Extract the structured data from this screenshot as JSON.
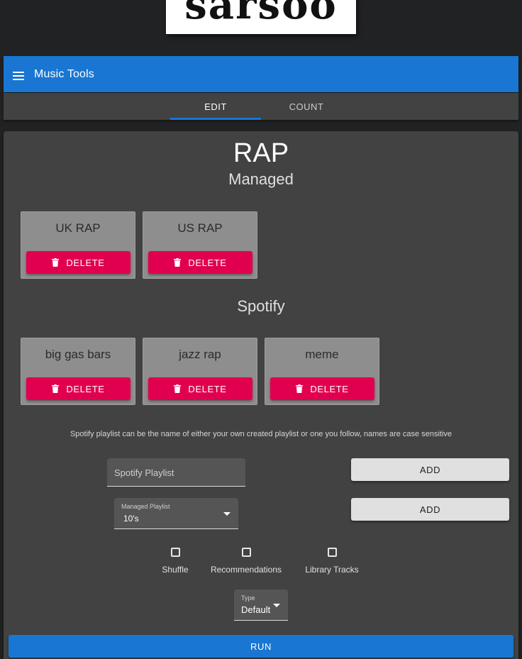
{
  "logo": {
    "text": "sarsoo"
  },
  "appbar": {
    "title": "Music Tools",
    "menu_icon": "menu-icon"
  },
  "tabs": [
    {
      "label": "EDIT",
      "active": true
    },
    {
      "label": "COUNT",
      "active": false
    }
  ],
  "playlist": {
    "name": "RAP"
  },
  "managed": {
    "heading": "Managed",
    "items": [
      {
        "name": "UK RAP",
        "delete_label": "DELETE"
      },
      {
        "name": "US RAP",
        "delete_label": "DELETE"
      }
    ]
  },
  "spotify": {
    "heading": "Spotify",
    "items": [
      {
        "name": "big gas bars",
        "delete_label": "DELETE"
      },
      {
        "name": "jazz rap",
        "delete_label": "DELETE"
      },
      {
        "name": "meme",
        "delete_label": "DELETE"
      }
    ]
  },
  "hint": "Spotify playlist can be the name of either your own created playlist or one you follow, names are case sensitive",
  "form": {
    "spotify_playlist": {
      "placeholder": "Spotify Playlist",
      "value": ""
    },
    "add_spotify_label": "ADD",
    "managed_playlist": {
      "label": "Managed Playlist",
      "value": "10's"
    },
    "add_managed_label": "ADD",
    "checkboxes": [
      {
        "label": "Shuffle",
        "checked": false
      },
      {
        "label": "Recommendations",
        "checked": false
      },
      {
        "label": "Library Tracks",
        "checked": false
      }
    ],
    "type": {
      "label": "Type",
      "value": "Default"
    },
    "run_label": "RUN"
  },
  "colors": {
    "background": "#212223",
    "appbar": "#1976d2",
    "panel": "#424242",
    "card": "#8e8e8e",
    "delete": "#e1004f",
    "add": "#e0e0e0",
    "run": "#1976d2"
  }
}
